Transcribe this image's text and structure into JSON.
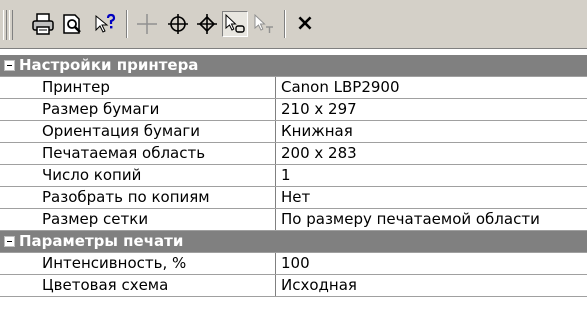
{
  "toolbar": {
    "icons": [
      "printer-icon",
      "print-preview-icon",
      "help-pointer-icon",
      "crosshair-icon",
      "circle-crosshair-icon",
      "diamond-crosshair-icon",
      "select-o-icon",
      "select-t-icon",
      "close-icon"
    ],
    "close_glyph": "×"
  },
  "grid": {
    "categories": [
      {
        "label": "Настройки принтера",
        "rows": [
          {
            "name": "Принтер",
            "value": "Canon LBP2900"
          },
          {
            "name": "Размер бумаги",
            "value": "210 x 297"
          },
          {
            "name": "Ориентация бумаги",
            "value": "Книжная"
          },
          {
            "name": "Печатаемая область",
            "value": "200 x 283"
          },
          {
            "name": "Число копий",
            "value": "1"
          },
          {
            "name": "Разобрать по копиям",
            "value": "Нет"
          },
          {
            "name": "Размер сетки",
            "value": "По размеру печатаемой области"
          }
        ]
      },
      {
        "label": "Параметры печати",
        "rows": [
          {
            "name": "Интенсивность, %",
            "value": "100"
          },
          {
            "name": "Цветовая схема",
            "value": "Исходная"
          }
        ]
      }
    ]
  },
  "colors": {
    "toolbar_bg": "#d4d0c8",
    "category_bg": "#808080",
    "gridline": "#a0a0a0"
  }
}
